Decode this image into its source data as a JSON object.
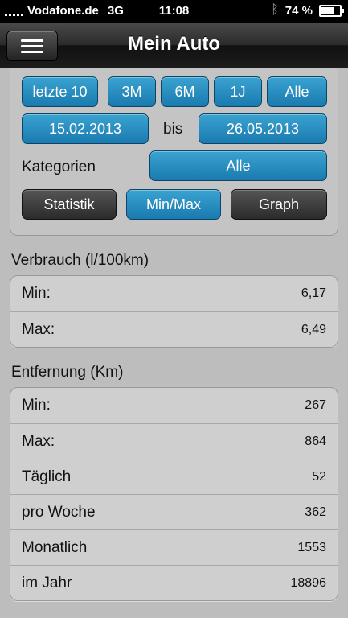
{
  "status": {
    "carrier": "Vodafone.de",
    "network": "3G",
    "time": "11:08",
    "battery": "74 %",
    "battery_level": 0.74
  },
  "nav": {
    "title": "Mein Auto"
  },
  "filters": {
    "ranges": [
      "letzte 10",
      "3M",
      "6M",
      "1J",
      "Alle"
    ],
    "date_from": "15.02.2013",
    "date_sep": "bis",
    "date_to": "26.05.2013",
    "category_label": "Kategorien",
    "category_value": "Alle",
    "views": [
      "Statistik",
      "Min/Max",
      "Graph"
    ],
    "active_view": "Min/Max"
  },
  "consumption": {
    "title": "Verbrauch (l/100km)",
    "rows": [
      {
        "label": "Min:",
        "value": "6,17"
      },
      {
        "label": "Max:",
        "value": "6,49"
      }
    ]
  },
  "distance": {
    "title": "Entfernung (Km)",
    "rows": [
      {
        "label": "Min:",
        "value": "267"
      },
      {
        "label": "Max:",
        "value": "864"
      },
      {
        "label": "Täglich",
        "value": "52"
      },
      {
        "label": "pro Woche",
        "value": "362"
      },
      {
        "label": "Monatlich",
        "value": "1553"
      },
      {
        "label": "im Jahr",
        "value": "18896"
      }
    ]
  },
  "colors": {
    "accent_blue": "#1a7ab0",
    "dark_button": "#2b2b2b",
    "background": "#bdbdbd"
  }
}
